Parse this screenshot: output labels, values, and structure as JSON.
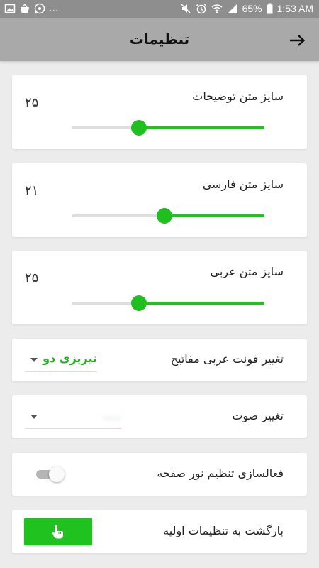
{
  "status_bar": {
    "dots": "...",
    "battery": "65%",
    "time": "1:53 AM",
    "icons": [
      "image-icon",
      "bag-icon",
      "whatsapp-icon",
      "mute-icon",
      "alarm-icon",
      "wifi-icon",
      "signal-icon",
      "battery-icon"
    ]
  },
  "app_bar": {
    "title": "تنظیمات",
    "back_icon": "arrow-right-icon"
  },
  "settings": {
    "description_size": {
      "label": "سایز متن توضیحات",
      "value": "۲۵",
      "level": 0.65
    },
    "persian_size": {
      "label": "سایز متن فارسی",
      "value": "۲۱",
      "level": 0.52
    },
    "arabic_size": {
      "label": "سایز متن عربی",
      "value": "۲۵",
      "level": 0.65
    },
    "arabic_font": {
      "label": "تغییر فونت عربی مفاتیح",
      "selected": "نیریزی دو"
    },
    "sound": {
      "label": "تغییر صوت",
      "selected": "......"
    },
    "screen_light": {
      "label": "فعالسازی تنظیم نور صفحه",
      "enabled": false
    },
    "reset": {
      "label": "بازگشت به تنظیمات اولیه",
      "icon": "touch-hand-icon"
    }
  },
  "colors": {
    "accent": "#1fc21f",
    "app_bar": "#a9a9a9",
    "status_bar": "#8e8e8e",
    "background": "#ececec"
  }
}
